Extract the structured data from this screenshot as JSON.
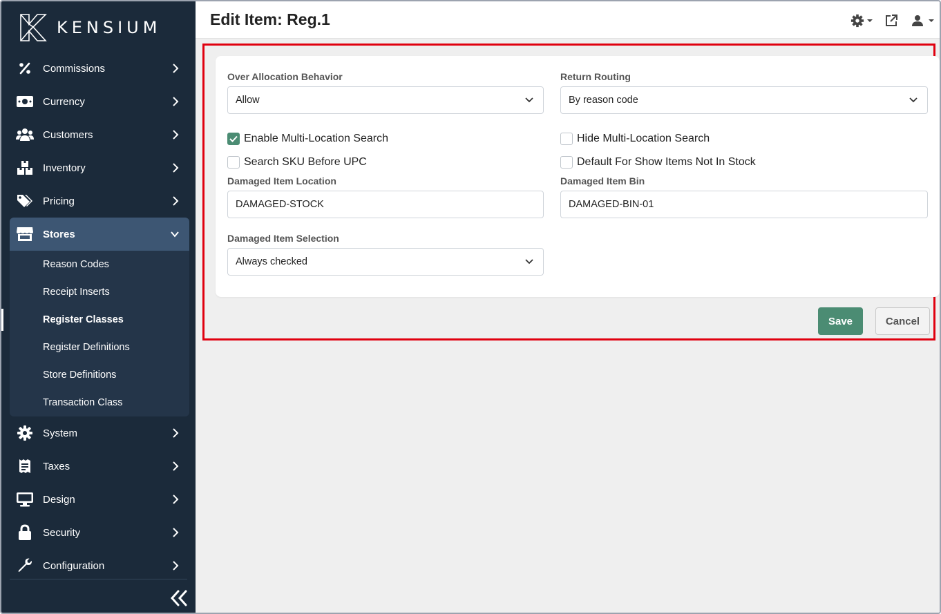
{
  "brand": {
    "name": "KENSIUM"
  },
  "sidebar": {
    "items": [
      {
        "label": "Commissions",
        "icon": "percent-icon"
      },
      {
        "label": "Currency",
        "icon": "money-bill-icon"
      },
      {
        "label": "Customers",
        "icon": "users-icon"
      },
      {
        "label": "Inventory",
        "icon": "boxes-icon"
      },
      {
        "label": "Pricing",
        "icon": "tags-icon"
      },
      {
        "label": "Stores",
        "icon": "store-icon",
        "expanded": true
      },
      {
        "label": "System",
        "icon": "gear-icon"
      },
      {
        "label": "Taxes",
        "icon": "receipt-icon"
      },
      {
        "label": "Design",
        "icon": "monitor-icon"
      },
      {
        "label": "Security",
        "icon": "lock-icon"
      },
      {
        "label": "Configuration",
        "icon": "wrench-icon"
      }
    ],
    "stores_children": [
      {
        "label": "Reason Codes"
      },
      {
        "label": "Receipt Inserts"
      },
      {
        "label": "Register Classes",
        "current": true
      },
      {
        "label": "Register Definitions"
      },
      {
        "label": "Store Definitions"
      },
      {
        "label": "Transaction Class"
      }
    ]
  },
  "header": {
    "title": "Edit Item: Reg.1"
  },
  "form": {
    "over_allocation": {
      "label": "Over Allocation Behavior",
      "value": "Allow"
    },
    "return_routing": {
      "label": "Return Routing",
      "value": "By reason code"
    },
    "enable_multi_location": {
      "label": "Enable Multi-Location Search",
      "checked": true
    },
    "hide_multi_location": {
      "label": "Hide Multi-Location Search",
      "checked": false
    },
    "search_sku": {
      "label": "Search SKU Before UPC",
      "checked": false
    },
    "default_show_items": {
      "label": "Default For Show Items Not In Stock",
      "checked": false
    },
    "damaged_location": {
      "label": "Damaged Item Location",
      "value": "DAMAGED-STOCK"
    },
    "damaged_bin": {
      "label": "Damaged Item Bin",
      "value": "DAMAGED-BIN-01"
    },
    "damaged_selection": {
      "label": "Damaged Item Selection",
      "value": "Always checked"
    }
  },
  "actions": {
    "save_label": "Save",
    "cancel_label": "Cancel"
  },
  "colors": {
    "sidebar_bg": "#1b2a3a",
    "active_bg": "#3d5673",
    "accent_green": "#4b8c73",
    "highlight_red": "#e0000f"
  }
}
